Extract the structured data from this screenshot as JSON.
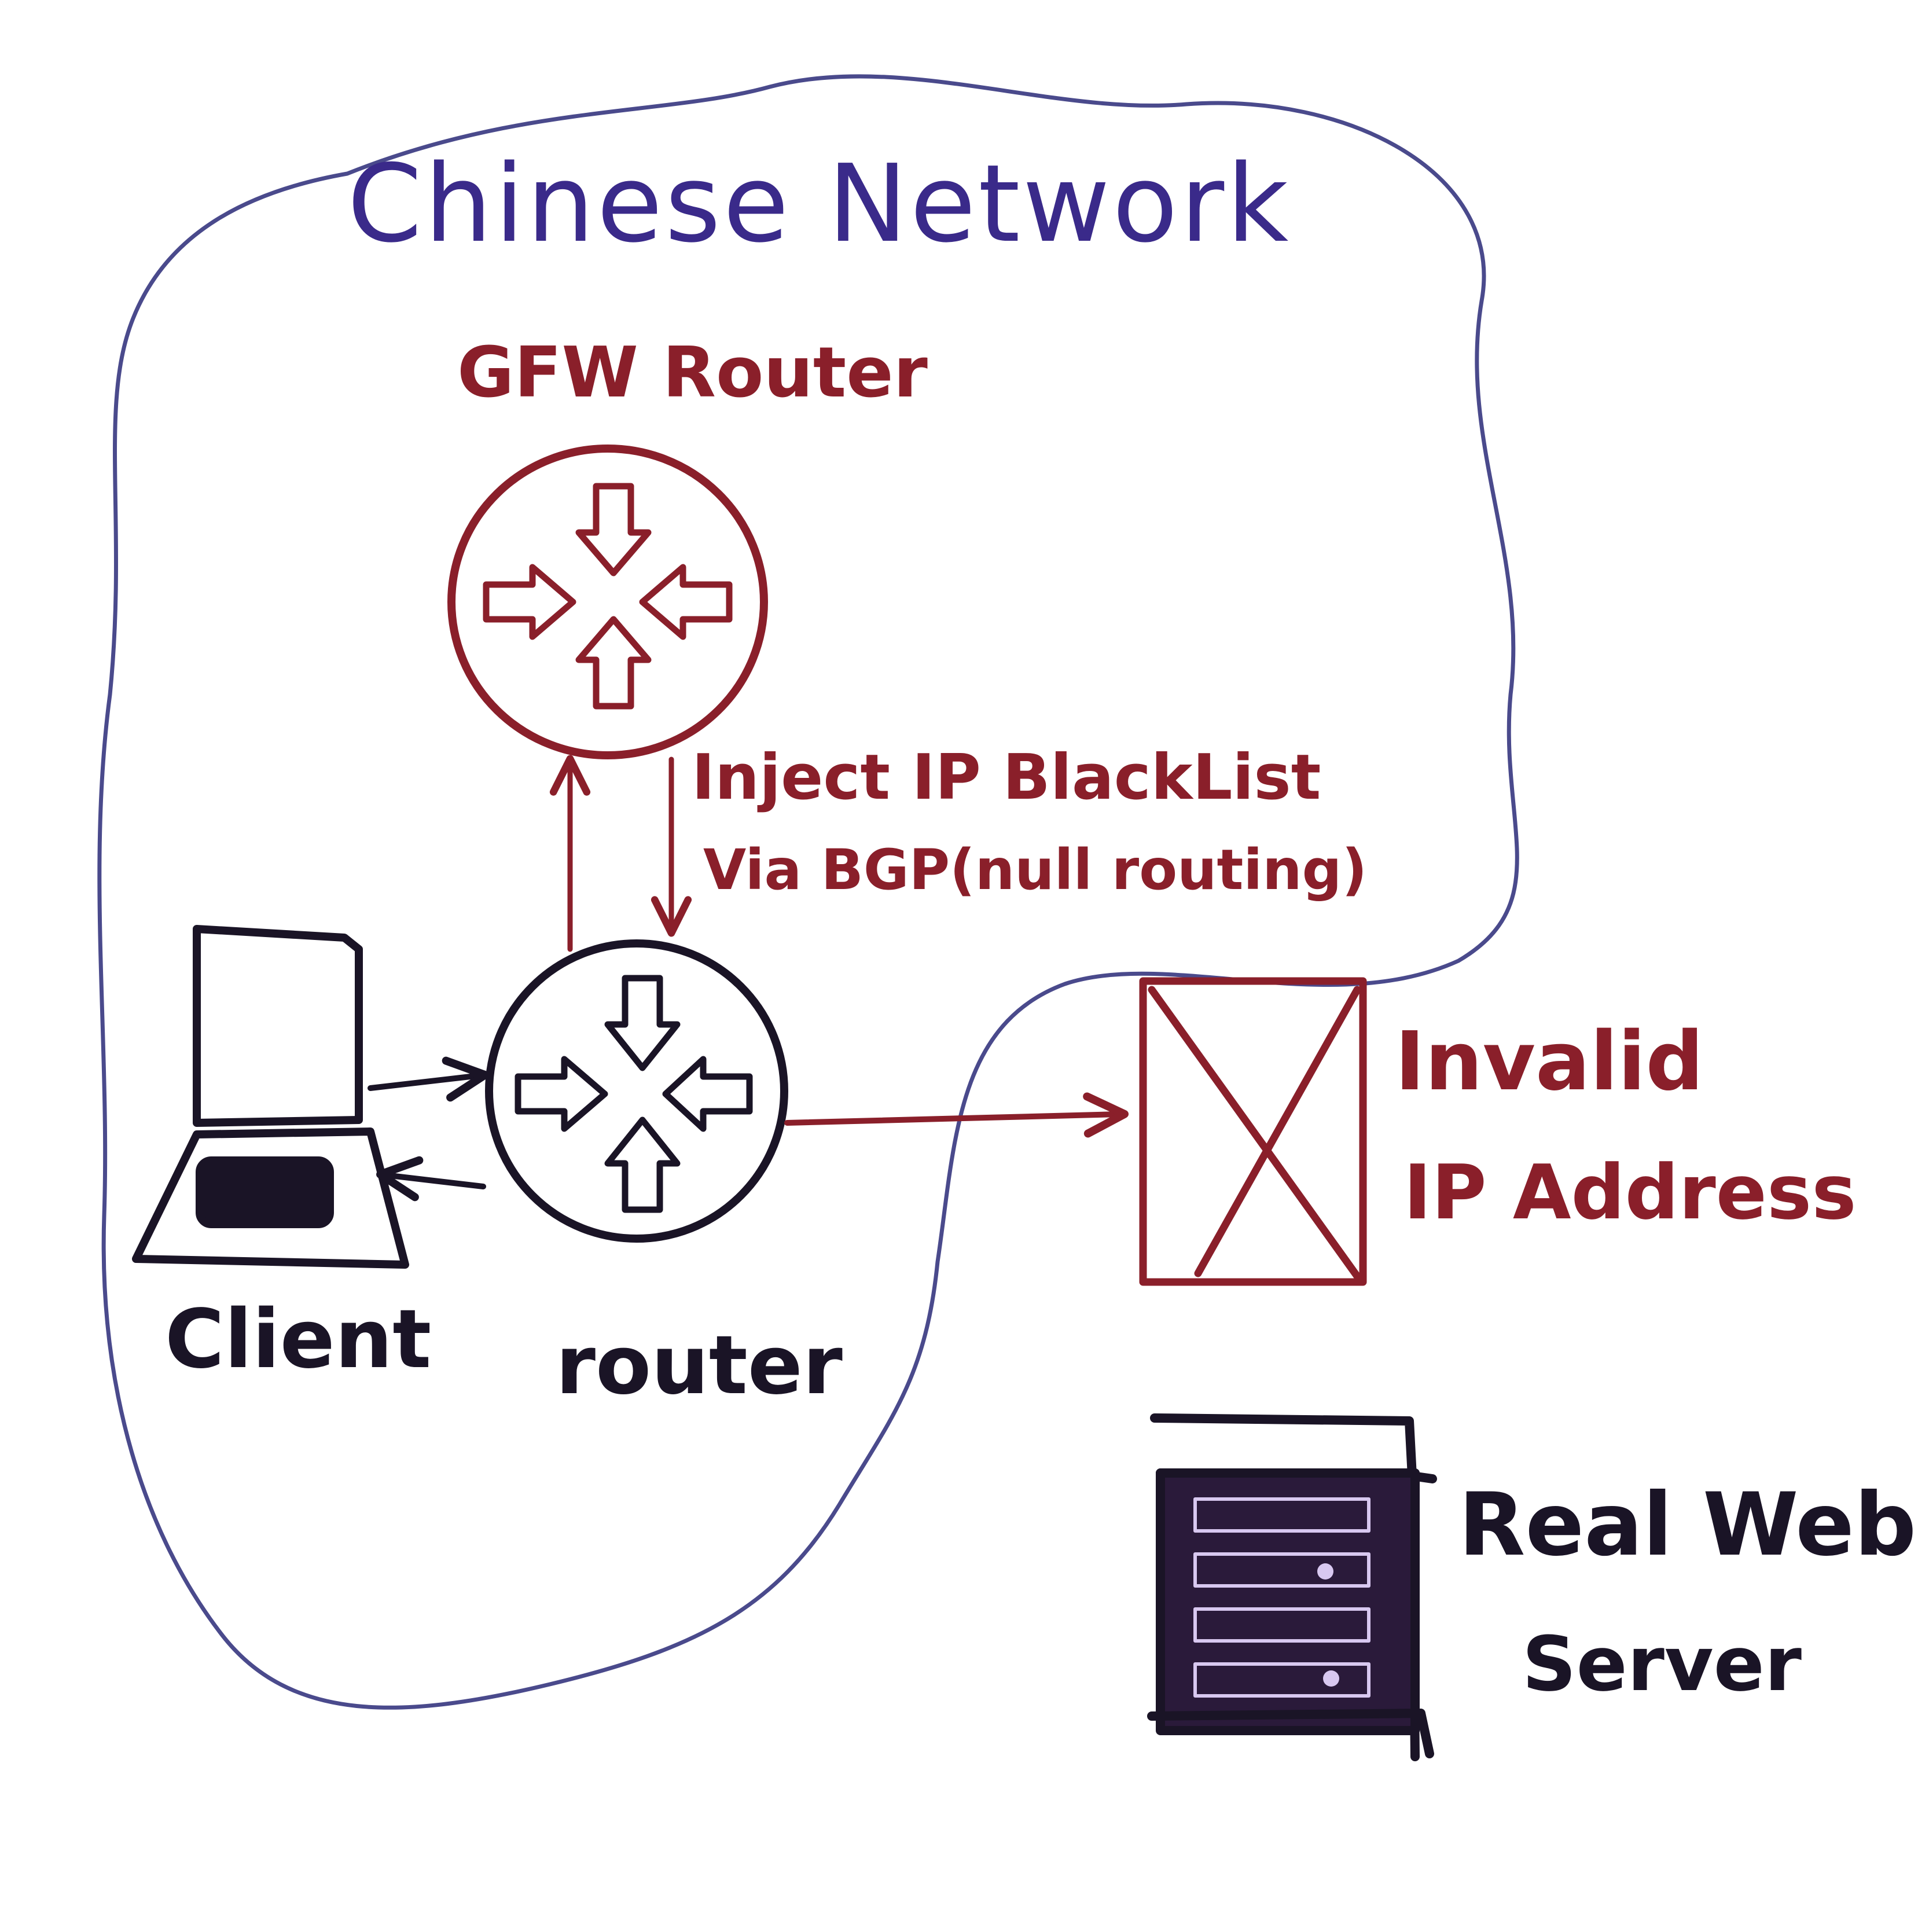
{
  "colors": {
    "network_outline": "#4a4a8c",
    "network_label": "#3a2a8a",
    "gfw": "#8a1f2a",
    "ink": "#1a1426",
    "invalid": "#8a1f2a"
  },
  "labels": {
    "network": "Chinese Network",
    "gfw_router": "GFW Router",
    "inject_line1": "Inject IP BlackList",
    "inject_line2": "Via BGP(null routing)",
    "client": "Client",
    "router": "router",
    "invalid_line1": "Invalid",
    "invalid_line2": "IP Address",
    "server_line1": "Real Web",
    "server_line2": "Server"
  },
  "icons": {
    "gfw": "router-icon",
    "router": "router-icon",
    "client": "laptop-icon",
    "invalid": "crossed-box-icon",
    "server": "server-rack-icon"
  }
}
